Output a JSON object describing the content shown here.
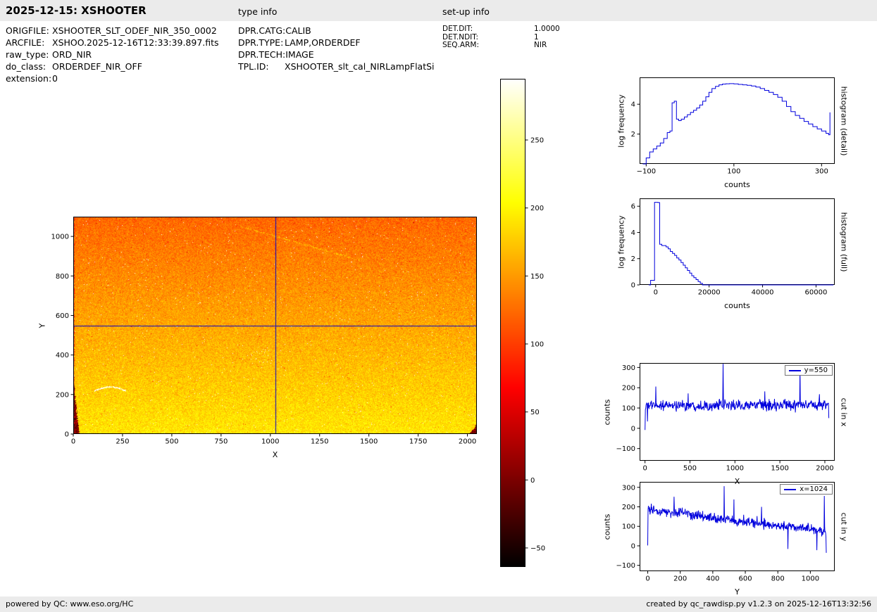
{
  "header": {
    "title": "2025-12-15: XSHOOTER",
    "type_info_label": "type info",
    "setup_info_label": "set-up info"
  },
  "file_info": {
    "rows": [
      {
        "label": "ORIGFILE:",
        "value": "XSHOOTER_SLT_ODEF_NIR_350_0002"
      },
      {
        "label": "ARCFILE:",
        "value": "XSHOO.2025-12-16T12:33:39.897.fits"
      },
      {
        "label": "raw_type:",
        "value": "ORD_NIR"
      },
      {
        "label": "do_class:",
        "value": "ORDERDEF_NIR_OFF"
      },
      {
        "label": "extension:",
        "value": "0"
      }
    ]
  },
  "type_info": {
    "rows": [
      {
        "label": "DPR.CATG:",
        "value": "CALIB"
      },
      {
        "label": "DPR.TYPE:",
        "value": "LAMP,ORDERDEF"
      },
      {
        "label": "DPR.TECH:",
        "value": "IMAGE"
      },
      {
        "label": "TPL.ID:",
        "value": "XSHOOTER_slt_cal_NIRLampFlatSi"
      }
    ]
  },
  "setup_info": {
    "rows": [
      {
        "label": "DET.DIT:",
        "value": "1.0000"
      },
      {
        "label": "DET.NDIT:",
        "value": "1"
      },
      {
        "label": "SEQ.ARM:",
        "value": "NIR"
      }
    ]
  },
  "footer": {
    "left_prefix": "powered by QC: ",
    "link": "www.eso.org/HC",
    "right": "created by qc_rawdisp.py v1.2.3 on 2025-12-16T13:32:56"
  },
  "colors": {
    "bar_background": "#ebebeb",
    "line_blue": "#0000dd",
    "crosshair_blue": "#0000cc"
  },
  "chart_data": [
    {
      "id": "detector_image",
      "type": "heatmap",
      "xlabel": "X",
      "ylabel": "Y",
      "xlim": [
        0,
        2048
      ],
      "ylim": [
        0,
        1100
      ],
      "xticks": [
        0,
        250,
        500,
        750,
        1000,
        1250,
        1500,
        1750,
        2000
      ],
      "yticks": [
        0,
        200,
        400,
        600,
        800,
        1000
      ],
      "colormap": "hot",
      "vmin": -64,
      "vmax": 295,
      "background_counts": {
        "bottom": 192,
        "top": 122
      },
      "noise_sigma": 12,
      "crosshair": {
        "x": 1024,
        "y": 550,
        "color": "#0000cc"
      },
      "features": [
        "dark low-count blob in bottom-left corner up to y~250",
        "dark low-count notch in bottom-right corner below y~60",
        "bright scratch arc near x 110-265, y~230",
        "scattered hot-pixel speckles",
        "faint diagonal scratch upper area x 850-1450"
      ]
    },
    {
      "id": "colorbar",
      "type": "colorbar",
      "colormap": "hot",
      "vmin": -64,
      "vmax": 295,
      "ticks": [
        -50,
        0,
        50,
        100,
        150,
        200,
        250
      ]
    },
    {
      "id": "histogram_detail",
      "type": "line",
      "step": true,
      "xlabel": "counts",
      "ylabel": "log frequency",
      "right_label": "histogram (detail)",
      "xlim": [
        -115,
        330
      ],
      "ylim": [
        0,
        5.8
      ],
      "xticks": [
        -100,
        100,
        300
      ],
      "yticks": [
        2,
        4
      ],
      "color": "#0000dd",
      "x": [
        -108,
        -100,
        -92,
        -84,
        -76,
        -68,
        -60,
        -52,
        -46,
        -41,
        -36,
        -31,
        -26,
        -20,
        -13,
        -6,
        1,
        8,
        15,
        22,
        29,
        36,
        43,
        50,
        58,
        66,
        74,
        82,
        90,
        100,
        110,
        120,
        130,
        140,
        150,
        160,
        170,
        180,
        190,
        200,
        210,
        220,
        230,
        240,
        250,
        260,
        270,
        280,
        290,
        300,
        310,
        316,
        319
      ],
      "y": [
        0,
        0.4,
        0.8,
        1.0,
        1.2,
        1.4,
        1.7,
        2.1,
        2.2,
        4.1,
        4.2,
        3.0,
        2.9,
        3.0,
        3.15,
        3.3,
        3.45,
        3.6,
        3.75,
        3.95,
        4.2,
        4.5,
        4.8,
        5.05,
        5.2,
        5.3,
        5.35,
        5.37,
        5.38,
        5.36,
        5.33,
        5.3,
        5.27,
        5.22,
        5.15,
        5.05,
        4.93,
        4.8,
        4.65,
        4.47,
        4.2,
        3.85,
        3.5,
        3.25,
        3.05,
        2.85,
        2.68,
        2.5,
        2.35,
        2.2,
        2.05,
        1.95,
        3.45
      ]
    },
    {
      "id": "histogram_full",
      "type": "line",
      "step": true,
      "xlabel": "counts",
      "ylabel": "log frequency",
      "right_label": "histogram (full)",
      "xlim": [
        -6000,
        67000
      ],
      "ylim": [
        0,
        6.6
      ],
      "xticks": [
        0,
        20000,
        40000,
        60000
      ],
      "yticks": [
        0,
        2,
        4,
        6
      ],
      "color": "#0000dd",
      "x": [
        -2600,
        -1900,
        -1200,
        -400,
        0,
        900,
        1500,
        2300,
        3100,
        3900,
        4700,
        5500,
        6300,
        7100,
        7900,
        8700,
        9500,
        10300,
        11100,
        11900,
        12700,
        13500,
        14300,
        15100,
        15900,
        16700,
        17500,
        66500
      ],
      "y": [
        0,
        0.35,
        0.35,
        6.3,
        6.3,
        6.28,
        3.1,
        3.0,
        3.0,
        2.9,
        2.75,
        2.55,
        2.4,
        2.25,
        2.05,
        1.9,
        1.7,
        1.5,
        1.3,
        1.1,
        0.9,
        0.7,
        0.55,
        0.4,
        0.25,
        0.12,
        0,
        0
      ]
    },
    {
      "id": "cut_x",
      "type": "line",
      "xlabel": "X",
      "ylabel": "counts",
      "right_label": "cut in x",
      "legend": "y=550",
      "xlim": [
        -60,
        2110
      ],
      "ylim": [
        -160,
        322
      ],
      "xticks": [
        0,
        500,
        1000,
        1500,
        2000
      ],
      "yticks": [
        -100,
        0,
        100,
        200,
        300
      ],
      "color": "#0000dd",
      "series_model": {
        "n": 2048,
        "stride": 4,
        "seed": 1234,
        "base_start": 112,
        "base_end": 114,
        "noise_sigma": 13,
        "spikes": [
          {
            "x": 0,
            "v": -8
          },
          {
            "x": 28,
            "v": 34
          },
          {
            "x": 120,
            "v": 206
          },
          {
            "x": 480,
            "v": 172
          },
          {
            "x": 868,
            "v": 318
          },
          {
            "x": 1330,
            "v": 182
          },
          {
            "x": 1724,
            "v": 296
          },
          {
            "x": 1940,
            "v": 168
          },
          {
            "x": 2044,
            "v": 50
          }
        ]
      }
    },
    {
      "id": "cut_y",
      "type": "line",
      "xlabel": "Y",
      "ylabel": "counts",
      "right_label": "cut in y",
      "legend": "x=1024",
      "xlim": [
        -50,
        1150
      ],
      "ylim": [
        -130,
        328
      ],
      "xticks": [
        0,
        200,
        400,
        600,
        800,
        1000
      ],
      "yticks": [
        -100,
        0,
        100,
        200,
        300
      ],
      "color": "#0000dd",
      "series_model": {
        "n": 1100,
        "stride": 2,
        "seed": 777,
        "base_start": 186,
        "base_end": 74,
        "noise_sigma": 12,
        "spikes": [
          {
            "x": 0,
            "v": 2
          },
          {
            "x": 162,
            "v": 252
          },
          {
            "x": 470,
            "v": 306
          },
          {
            "x": 530,
            "v": 238
          },
          {
            "x": 700,
            "v": 200
          },
          {
            "x": 862,
            "v": -16
          },
          {
            "x": 1040,
            "v": -22
          },
          {
            "x": 1086,
            "v": 256
          },
          {
            "x": 1097,
            "v": -36
          }
        ]
      }
    }
  ]
}
